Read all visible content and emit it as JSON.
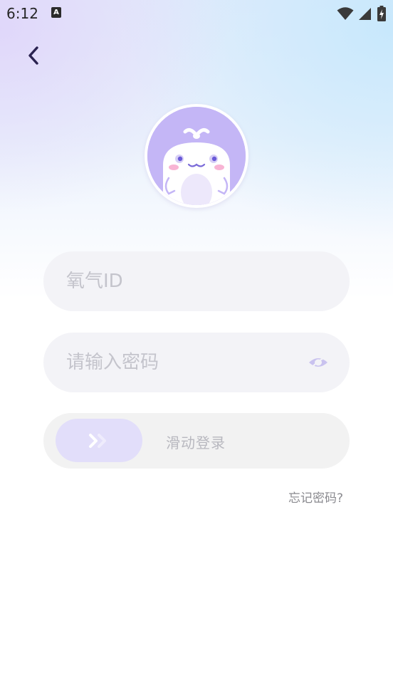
{
  "status_bar": {
    "time": "6:12",
    "notification_icon": "a-letter-icon",
    "notification_glyph": "A",
    "icons": [
      "wifi-icon",
      "cellular-signal-icon",
      "battery-charging-icon"
    ]
  },
  "nav": {
    "back_icon": "chevron-left-icon"
  },
  "avatar": {
    "icon": "whale-mascot-avatar",
    "bg_color": "#c4b6f6"
  },
  "form": {
    "id_placeholder": "氧气ID",
    "id_value": "",
    "password_placeholder": "请输入密码",
    "password_value": "",
    "password_toggle_icon": "eye-hidden-icon"
  },
  "slider": {
    "label": "滑动登录",
    "thumb_icon": "double-chevron-right-icon",
    "progress": 0
  },
  "forgot_password_label": "忘记密码?",
  "colors": {
    "accent": "#c4b6f6",
    "thumb": "#e2defa",
    "field_bg": "#f3f3f7",
    "placeholder": "#c4c4cc",
    "back_arrow": "#2a2250"
  }
}
